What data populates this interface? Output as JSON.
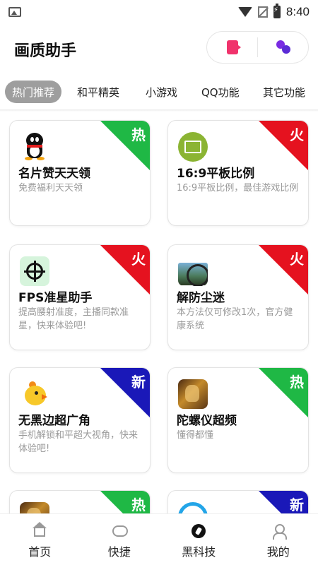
{
  "status_bar": {
    "time": "8:40"
  },
  "header": {
    "title": "画质助手"
  },
  "tabs": [
    {
      "label": "热门推荐",
      "active": true
    },
    {
      "label": "和平精英"
    },
    {
      "label": "小游戏"
    },
    {
      "label": "QQ功能"
    },
    {
      "label": "其它功能"
    }
  ],
  "cards": [
    {
      "title": "名片赞天天领",
      "desc": "免费福利天天领",
      "badge": "热",
      "badge_color": "#1fb845",
      "icon": "qq-penguin-icon"
    },
    {
      "title": "16:9平板比例",
      "desc": "16:9平板比例，最佳游戏比例",
      "badge": "火",
      "badge_color": "#e5121f",
      "icon": "tablet-icon"
    },
    {
      "title": "FPS准星助手",
      "desc": "提高腰射准度，主播同款准星，快来体验吧!",
      "badge": "火",
      "badge_color": "#e5121f",
      "icon": "crosshair-icon"
    },
    {
      "title": "解防尘迷",
      "desc": "本方法仅可修改1次，官方健康系统",
      "badge": "火",
      "badge_color": "#e5121f",
      "icon": "scope-icon"
    },
    {
      "title": "无黑边超广角",
      "desc": "手机解锁和平超大视角，快来体验吧!",
      "badge": "新",
      "badge_color": "#1a18b8",
      "icon": "chick-icon"
    },
    {
      "title": "陀螺仪超频",
      "desc": "懂得都懂",
      "badge": "热",
      "badge_color": "#1fb845",
      "icon": "game-art-icon"
    },
    {
      "title": "",
      "desc": "",
      "badge": "热",
      "badge_color": "#1fb845",
      "icon": "game-art-icon"
    },
    {
      "title": "",
      "desc": "",
      "badge": "新",
      "badge_color": "#1a18b8",
      "icon": "ring-icon"
    }
  ],
  "bottom_nav": [
    {
      "label": "首页",
      "icon": "home-icon"
    },
    {
      "label": "快捷",
      "icon": "gamepad-icon"
    },
    {
      "label": "黑科技",
      "icon": "tech-icon"
    },
    {
      "label": "我的",
      "icon": "me-icon"
    }
  ]
}
